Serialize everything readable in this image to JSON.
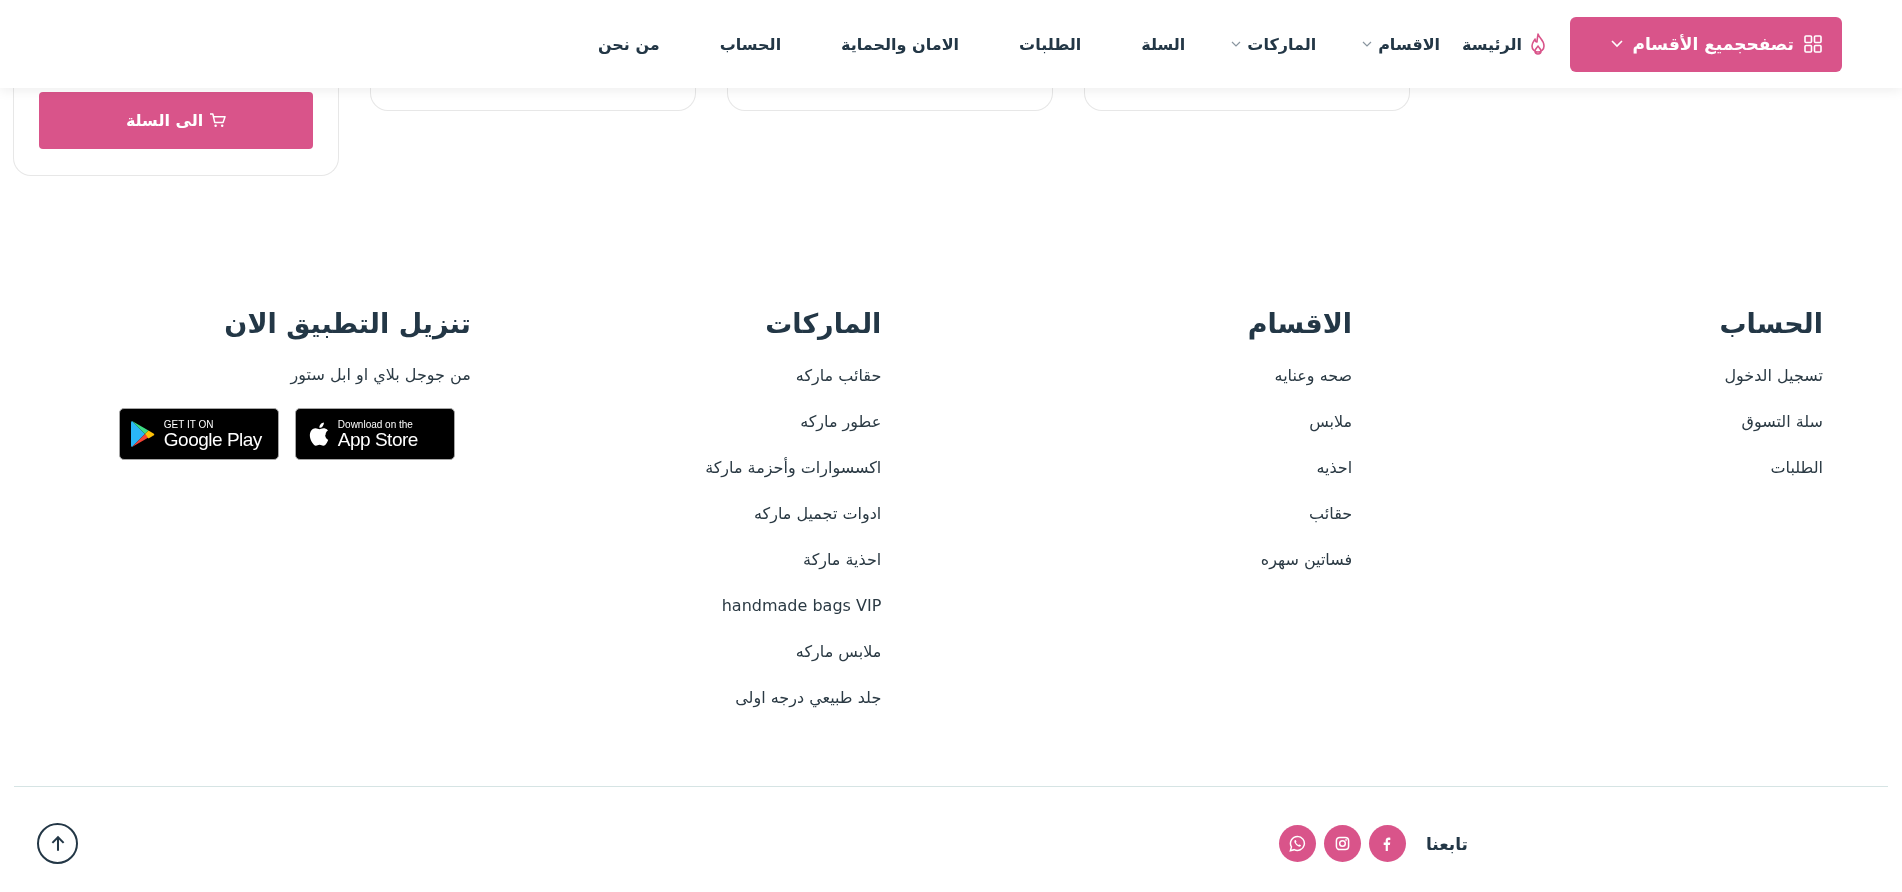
{
  "header": {
    "browse_button": {
      "label": "تصفحجميع الأقسام"
    },
    "nav": [
      {
        "label": "الرئيسة",
        "kind": "icon"
      },
      {
        "label": "الاقسام",
        "kind": "dropdown"
      },
      {
        "label": "الماركات",
        "kind": "dropdown"
      },
      {
        "label": "السلة",
        "kind": "plain"
      },
      {
        "label": "الطلبات",
        "kind": "plain"
      },
      {
        "label": "الامان والحماية",
        "kind": "plain"
      },
      {
        "label": "الحساب",
        "kind": "plain"
      },
      {
        "label": "من نحن",
        "kind": "plain"
      }
    ]
  },
  "product_cards": [
    {
      "kind": "empty"
    },
    {
      "kind": "empty"
    },
    {
      "kind": "empty"
    },
    {
      "kind": "cart",
      "button": "الى السلة"
    }
  ],
  "footer": {
    "columns": [
      {
        "title": "الحساب",
        "links": [
          "تسجيل الدخول",
          "سلة التسوق",
          "الطلبات"
        ]
      },
      {
        "title": "الاقسام",
        "links": [
          "صحه وعنايه",
          "ملابس",
          "احذيه",
          "حقائب",
          "فساتين سهره"
        ]
      },
      {
        "title": "الماركات",
        "links": [
          "حقائب ماركه",
          "عطور ماركه",
          "اكسسوارات وأحزمة ماركة",
          "ادوات تجميل ماركه",
          "احذية ماركة",
          "handmade bags VIP",
          "ملابس ماركه",
          "جلد طبيعي درجه اولى"
        ]
      }
    ],
    "app": {
      "title": "تنزيل التطبيق الان",
      "text": "من جوجل بلاي او ابل ستور",
      "badges": [
        {
          "kind": "app-store",
          "small": "Download on the",
          "big": "App Store"
        },
        {
          "kind": "google-play",
          "small": "GET IT ON",
          "big": "Google Play"
        }
      ]
    }
  },
  "bottom": {
    "follow_label": "تابعنا",
    "social": [
      {
        "kind": "facebook"
      },
      {
        "kind": "instagram"
      },
      {
        "kind": "whatsapp"
      }
    ]
  }
}
